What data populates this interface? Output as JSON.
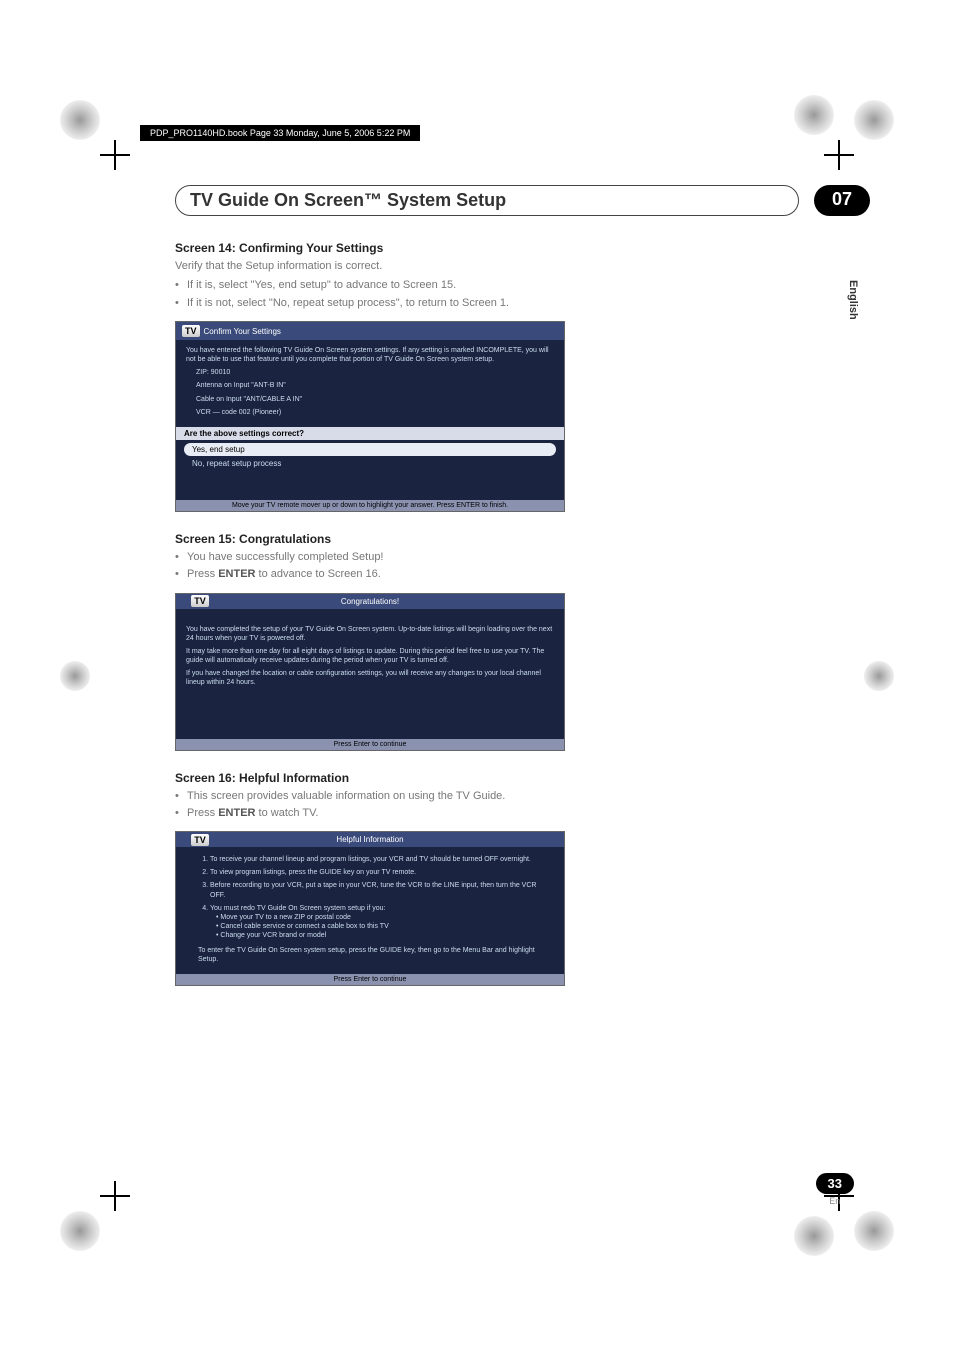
{
  "page_ref": "PDP_PRO1140HD.book  Page 33  Monday, June 5, 2006  5:22 PM",
  "chapter": {
    "title": "TV Guide On Screen™ System Setup",
    "number": "07"
  },
  "side_lang": "English",
  "screen14": {
    "heading": "Screen 14: Confirming Your Settings",
    "desc": "Verify that the Setup information is correct.",
    "b1": "If it is, select \"Yes, end setup\" to advance to Screen 15.",
    "b2": "If it is not, select \"No, repeat setup process\", to return to Screen 1.",
    "ss": {
      "title": "Confirm Your Settings",
      "intro": "You have entered the following TV Guide On Screen system settings. If any setting is marked INCOMPLETE, you will not be able to use that feature until you complete that portion of TV Guide On Screen system setup.",
      "zip": "ZIP: 90010",
      "ant": "Antenna on Input \"ANT-B IN\"",
      "cable": "Cable on Input \"ANT/CABLE A IN\"",
      "vcr": "VCR — code 002 (Pioneer)",
      "question": "Are the above settings correct?",
      "opt1": "Yes, end setup",
      "opt2": "No, repeat setup process",
      "footer": "Move your TV remote mover up or down to highlight your answer. Press ENTER to finish."
    }
  },
  "screen15": {
    "heading": "Screen 15: Congratulations",
    "b1": "You have successfully completed Setup!",
    "b2_pre": "Press ",
    "b2_bold": "ENTER",
    "b2_post": " to advance to Screen 16.",
    "ss": {
      "title": "Congratulations!",
      "p1": "You have completed the setup of your TV Guide On Screen system. Up-to-date listings will begin loading over the next 24 hours when your TV is powered off.",
      "p2": "It may take more than one day for all eight days of listings to update. During this period feel free to use your TV. The guide will automatically receive updates during the period when your TV is turned off.",
      "p3": "If you have changed the location or cable configuration settings, you will receive any changes to your local channel lineup within 24 hours.",
      "footer": "Press Enter to continue"
    }
  },
  "screen16": {
    "heading": "Screen 16: Helpful Information",
    "b1": "This screen provides valuable information on using the TV Guide.",
    "b2_pre": "Press ",
    "b2_bold": "ENTER",
    "b2_post": " to watch TV.",
    "ss": {
      "title": "Helpful Information",
      "l1": "To receive your channel lineup and program listings, your VCR and TV should be turned OFF overnight.",
      "l2": "To view program listings, press the GUIDE key on your TV remote.",
      "l3": "Before recording to your VCR, put a tape in your VCR, tune the VCR to the LINE input, then turn the VCR OFF.",
      "l4": "You must redo TV Guide On Screen system setup if you:",
      "l4a": "• Move your TV to a new ZIP or postal code",
      "l4b": "• Cancel cable service or connect a cable box to this TV",
      "l4c": "• Change your VCR brand or model",
      "l5": "To enter the TV Guide On Screen system setup, press the GUIDE key, then go to the Menu Bar and highlight Setup.",
      "footer": "Press Enter to continue"
    }
  },
  "footer": {
    "page_num": "33",
    "lang": "En"
  },
  "icons": {
    "tv_logo": "TV",
    "guide_label": "GUIDE"
  }
}
